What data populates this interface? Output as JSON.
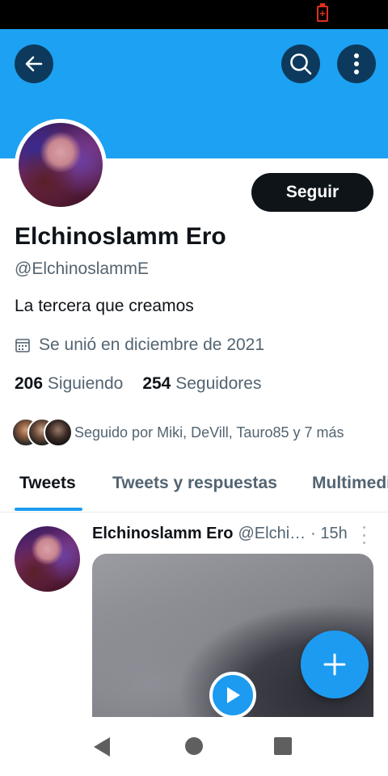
{
  "status_bar": {
    "battery_icon": "battery-charging-icon",
    "battery_color": "#e0301e"
  },
  "header": {
    "banner_color": "#1da1f2",
    "back_icon": "arrow-left-icon",
    "search_icon": "search-icon",
    "more_icon": "more-vertical-icon"
  },
  "profile": {
    "follow_label": "Seguir",
    "name": "Elchinoslamm Ero",
    "handle": "@ElchinoslammE",
    "bio": "La tercera que creamos",
    "joined": "Se unió en diciembre de 2021",
    "following_count": "206",
    "following_label": "Siguiendo",
    "followers_count": "254",
    "followers_label": "Seguidores",
    "followed_by": "Seguido por Miki, DeVill, Tauro85 y 7 más"
  },
  "tabs": [
    {
      "label": "Tweets",
      "active": true
    },
    {
      "label": "Tweets y respuestas",
      "active": false
    },
    {
      "label": "Multimedia",
      "active": false
    }
  ],
  "tweet": {
    "name": "Elchinoslamm Ero",
    "handle": "@Elchi…",
    "time": "· 15h"
  },
  "fab": {
    "icon": "plus-icon",
    "color": "#1d9bf0"
  },
  "nav": {
    "back_icon": "triangle-back-icon",
    "home_icon": "circle-home-icon",
    "recent_icon": "square-recents-icon"
  },
  "accent_color": "#1d9bf0"
}
